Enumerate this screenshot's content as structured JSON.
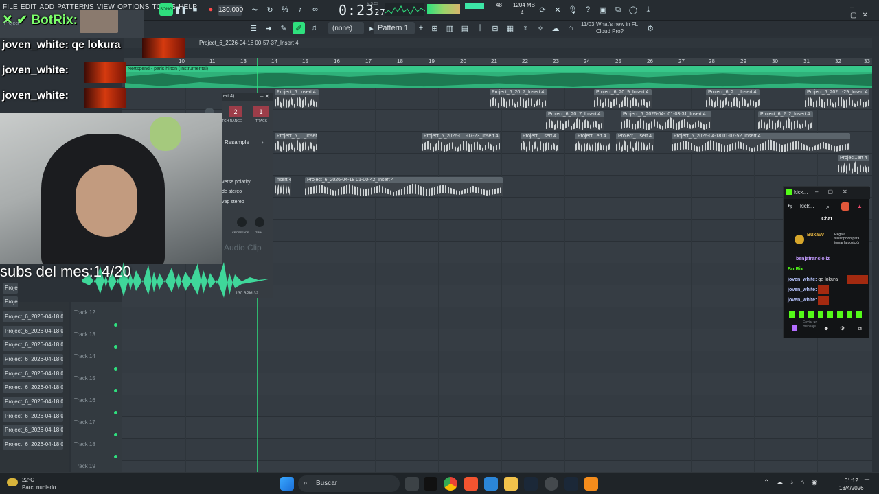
{
  "menu": [
    "FILE",
    "EDIT",
    "ADD",
    "PATTERNS",
    "VIEW",
    "OPTIONS",
    "TOOLS",
    "HELP"
  ],
  "transport": {
    "song_label": "SONG",
    "bpm": "130.000",
    "time": "0:23",
    "time_small": "27",
    "time_label": "M:S:CS",
    "mem": "1204 MB",
    "cpu": "48",
    "voices": "4"
  },
  "toolbar": {
    "snap": "(none)",
    "pattern": "Pattern 1",
    "news_date": "11/03",
    "news_text": "What's new in FL Cloud Pro?"
  },
  "playlist": {
    "title": "Project_6_2026-04-18 00-57-37_Insert 4",
    "ruler_ticks": [
      "10",
      "11",
      "12",
      "13",
      "14",
      "15",
      "16",
      "17",
      "18",
      "19",
      "20",
      "21",
      "22",
      "23",
      "24",
      "25",
      "26",
      "27",
      "28",
      "29",
      "30",
      "31",
      "32",
      "33"
    ],
    "music_clip": "Nettspend - paris hilton (Instrumental)",
    "clips": [
      {
        "label": "Project_6...nsert 4"
      },
      {
        "label": "Project_6_20..7_Insert 4"
      },
      {
        "label": "Project_6_20..9_Insert 4"
      },
      {
        "label": "Project_6_2..._Insert 4"
      },
      {
        "label": "Project_6_202...-29_Insert 4"
      },
      {
        "label": "Project_6_20..7_Insert 4"
      },
      {
        "label": "Project_6_2026-04-..01-03-31_Insert 4"
      },
      {
        "label": "Project_6_2..2_Insert 4"
      },
      {
        "label": "Project_6_..._Insert 4"
      },
      {
        "label": "Project_6_2026-0...-07-23_Insert 4"
      },
      {
        "label": "Project_...sert 4"
      },
      {
        "label": "Project...ert 4"
      },
      {
        "label": "Project_...sert 4"
      },
      {
        "label": "Project_6_2026-04-18 01-07-52_Insert 4"
      },
      {
        "label": "Projec...ert 4"
      },
      {
        "label": "nsert 4"
      },
      {
        "label": "Project_6_2026-04-18 01-00-42_Insert 4"
      }
    ],
    "tracks": [
      "Track 12",
      "Track 13",
      "Track 14",
      "Track 15",
      "Track 16",
      "Track 17",
      "Track 18",
      "Track 19"
    ],
    "picker_items": [
      "Proje",
      "Proje",
      "Project_6_2026-04-18 0...",
      "Project_6_2026-04-18 0...",
      "Project_6_2026-04-18 0...",
      "Project_6_2026-04-18 0...",
      "Project_6_2026-04-18 0...",
      "Project_6_2026-04-18 0...",
      "Project_6_2026-04-18 0...",
      "Project_6_2026-04-18 0...",
      "Project_6_2026-04-18 0...",
      "Project_6_2026-04-18 0..."
    ]
  },
  "plugin": {
    "title": "ert 4)",
    "range": "2",
    "track": "1",
    "range_label": "TCH RANGE",
    "track_label": "TRACK",
    "resample": "Resample",
    "opt1": "verse polarity",
    "opt2": "de stereo",
    "opt3": "vap stereo",
    "crossfade": "CROSSFADE",
    "trim": "TRIM",
    "clip_type": "Audio Clip",
    "bpm_info": "130 BPM 32"
  },
  "overlay": {
    "botrix": "BotRix:",
    "chat": [
      {
        "user": "joven_white:",
        "msg": "qe lokura"
      },
      {
        "user": "joven_white:",
        "msg": ""
      },
      {
        "user": "joven_white:",
        "msg": ""
      }
    ],
    "subs": "subs del mes:14/20",
    "project_hint": "Project"
  },
  "kick": {
    "tab": "kick...",
    "address": "kick...",
    "header": "Chat",
    "pinned_user": "Buxavv",
    "pinned_msg": "Regala 1 suscripción para tomar la posición",
    "messages": [
      {
        "user": "benjafrancioliz",
        "msg": ""
      },
      {
        "user": "BotRix:",
        "msg": ""
      },
      {
        "user": "joven_white:",
        "msg": "qe lokura"
      },
      {
        "user": "joven_white:",
        "msg": ""
      },
      {
        "user": "joven_white:",
        "msg": ""
      }
    ],
    "input_placeholder": "Enviar un mensaje"
  },
  "taskbar": {
    "search": "Buscar",
    "temp": "22°C",
    "weather": "Parc. nublado",
    "time": "01:12",
    "date": "18/4/2026"
  }
}
